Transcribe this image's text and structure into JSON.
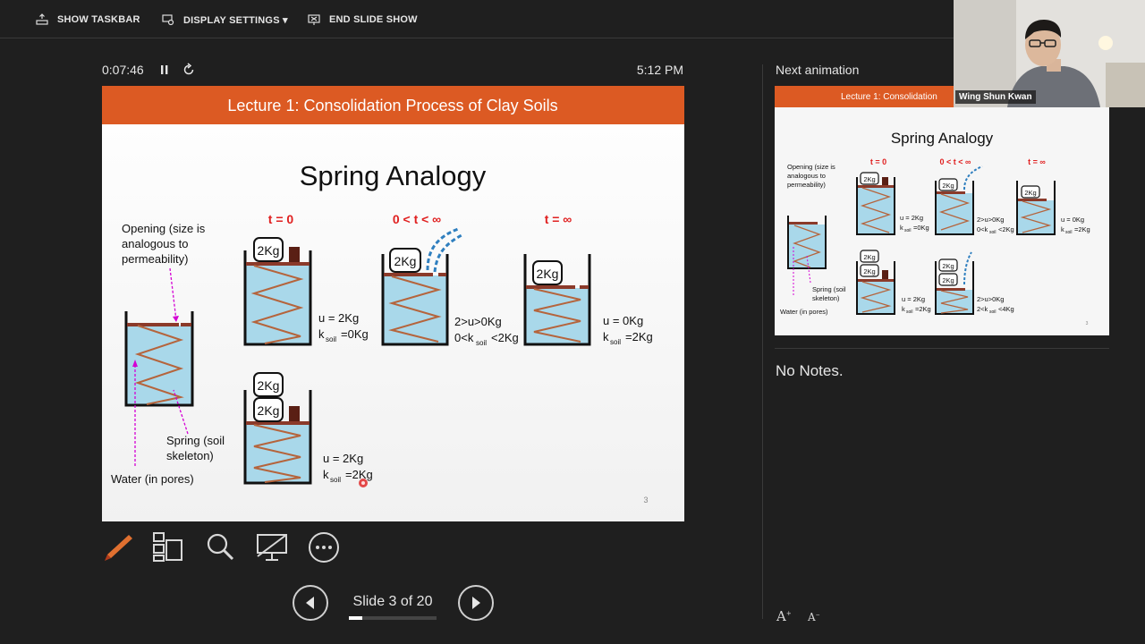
{
  "toolbar": {
    "show_taskbar": "SHOW TASKBAR",
    "display_settings": "DISPLAY SETTINGS ▾",
    "end_slide_show": "END SLIDE SHOW"
  },
  "presenter": {
    "timer": "0:07:46",
    "clock": "5:12 PM",
    "slide_counter": "Slide 3 of 20",
    "slide_progress": 0.15,
    "next_label": "Next animation",
    "notes": "No Notes.",
    "speaker_name": "Wing Shun Kwan"
  },
  "slide": {
    "header": "Lecture 1: Consolidation Process of Clay Soils",
    "title": "Spring Analogy",
    "label_t0": "t = 0",
    "label_tmid": "0 < t < ∞",
    "label_tinf": "t = ∞",
    "opening_1": "Opening (size is",
    "opening_2": "analogous to",
    "opening_3": "permeability)",
    "spring_1": "Spring (soil",
    "spring_2": "skeleton)",
    "water": "Water (in pores)",
    "weight": "2Kg",
    "t0_u": "u = 2Kg",
    "t0_k": "=0Kg",
    "mid_u": "2>u>0Kg",
    "mid_k_a": "0<k",
    "mid_k_b": "<2Kg",
    "inf_u": "u = 0Kg",
    "inf_k": "=2Kg",
    "double_u": "u = 2Kg",
    "double_k": "=2Kg",
    "k_sym": "k",
    "k_sub": "soil",
    "page_number": "3"
  },
  "next_slide": {
    "header": "Lecture 1: Consolidation",
    "title": "Spring Analogy",
    "label_t0": "t = 0",
    "label_tmid": "0 < t < ∞",
    "label_tinf": "t = ∞",
    "opening_1": "Opening (size is",
    "opening_2": "analogous to",
    "opening_3": "permeability)",
    "spring_1": "Spring (soil",
    "spring_2": "skeleton)",
    "water": "Water (in pores)",
    "weight": "2Kg",
    "r1_u": "u = 2Kg",
    "r1_k": "=0Kg",
    "r2_u": "2>u>0Kg",
    "r2_k_a": "0<k",
    "r2_k_b": "<2Kg",
    "r3_u": "u = 0Kg",
    "r3_k": "=2Kg",
    "r4_u": "u = 2Kg",
    "r4_k": "=2Kg",
    "r5_u": "2>u>0Kg",
    "r5_k_a": "2<k",
    "r5_k_b": "<4Kg",
    "k_sym": "k",
    "k_sub": "soil",
    "page_number": "3"
  },
  "colors": {
    "header_bar": "#dc5a23",
    "title_red": "#e02020",
    "water": "#a9d8ea",
    "spring": "#b5643c",
    "pink_arrow": "#d400d4"
  },
  "icons": [
    "taskbar-icon",
    "display-settings-icon",
    "end-slideshow-icon",
    "pause-icon",
    "restart-icon",
    "pen-tool-icon",
    "see-all-slides-icon",
    "zoom-icon",
    "black-screen-icon",
    "more-options-icon",
    "previous-arrow-icon",
    "next-arrow-icon",
    "font-larger-icon",
    "font-smaller-icon"
  ]
}
